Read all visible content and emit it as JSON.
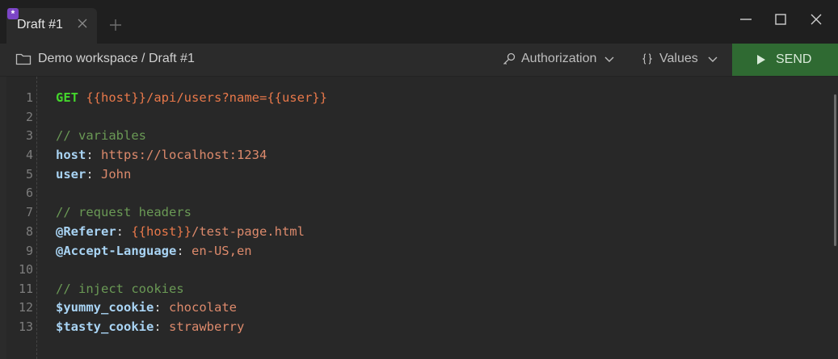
{
  "tab": {
    "label": "Draft #1",
    "dirty_badge": "*"
  },
  "breadcrumb": {
    "text": "Demo workspace / Draft #1"
  },
  "toolbar": {
    "authorization_label": "Authorization",
    "values_label": "Values",
    "send_label": "SEND"
  },
  "colors": {
    "send_button": "#2f6a32",
    "dirty_badge": "#7b45c6",
    "method": "#44d62c",
    "variable": "#e8784a",
    "comment": "#6a9955",
    "key": "#a9d4f4"
  },
  "editor": {
    "line_numbers": [
      "1",
      "2",
      "3",
      "4",
      "5",
      "6",
      "7",
      "8",
      "9",
      "10",
      "11",
      "12",
      "13"
    ],
    "lines": {
      "l1": {
        "method": "GET",
        "host_var": "{{host}}",
        "path": "/api/users?name=",
        "user_var": "{{user}}"
      },
      "l3": {
        "comment": "// variables"
      },
      "l4": {
        "key": "host",
        "sep": ": ",
        "value": "https://localhost:1234"
      },
      "l5": {
        "key": "user",
        "sep": ": ",
        "value": "John"
      },
      "l7": {
        "comment": "// request headers"
      },
      "l8": {
        "key": "@Referer",
        "sep": ": ",
        "host_var": "{{host}}",
        "value": "/test-page.html"
      },
      "l9": {
        "key": "@Accept-Language",
        "sep": ": ",
        "value": "en-US,en"
      },
      "l11": {
        "comment": "// inject cookies"
      },
      "l12": {
        "key": "$yummy_cookie",
        "sep": ": ",
        "value": "chocolate"
      },
      "l13": {
        "key": "$tasty_cookie",
        "sep": ": ",
        "value": "strawberry"
      }
    }
  }
}
